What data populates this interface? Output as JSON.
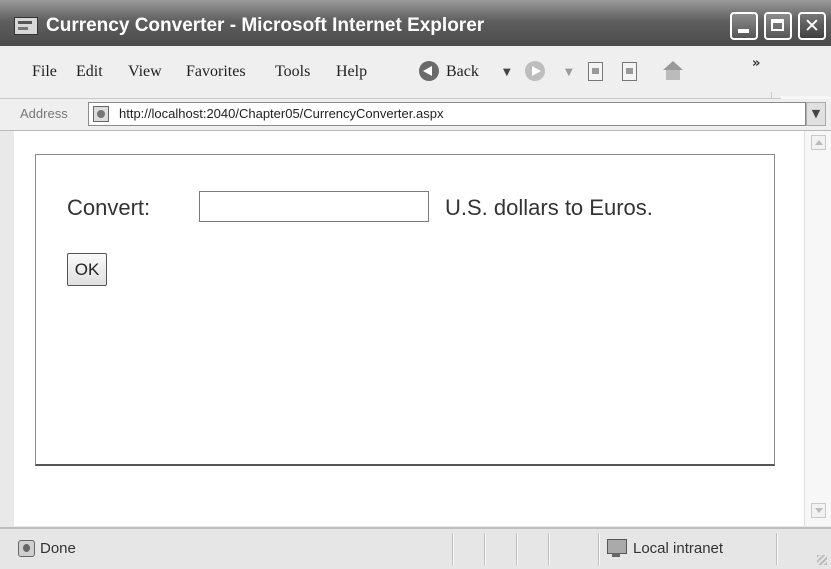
{
  "window": {
    "title": "Currency Converter - Microsoft Internet Explorer",
    "controls": {
      "minimize": "minimize",
      "maximize": "maximize",
      "close": "✕"
    }
  },
  "menubar": {
    "items": [
      "File",
      "Edit",
      "View",
      "Favorites",
      "Tools",
      "Help"
    ],
    "back_label": "Back",
    "overflow": "»"
  },
  "address": {
    "label": "Address",
    "url": "http://localhost:2040/Chapter05/CurrencyConverter.aspx"
  },
  "form": {
    "convert_label": "Convert:",
    "amount_value": "",
    "suffix_label": "U.S. dollars to Euros.",
    "ok_label": "OK"
  },
  "status": {
    "text": "Done",
    "zone": "Local intranet"
  },
  "icons": {
    "app": "ie-page-icon",
    "back": "back-arrow-icon",
    "forward": "forward-arrow-icon",
    "stop": "stop-icon",
    "refresh": "refresh-icon",
    "home": "home-icon",
    "brand": "windows-logo-icon"
  }
}
